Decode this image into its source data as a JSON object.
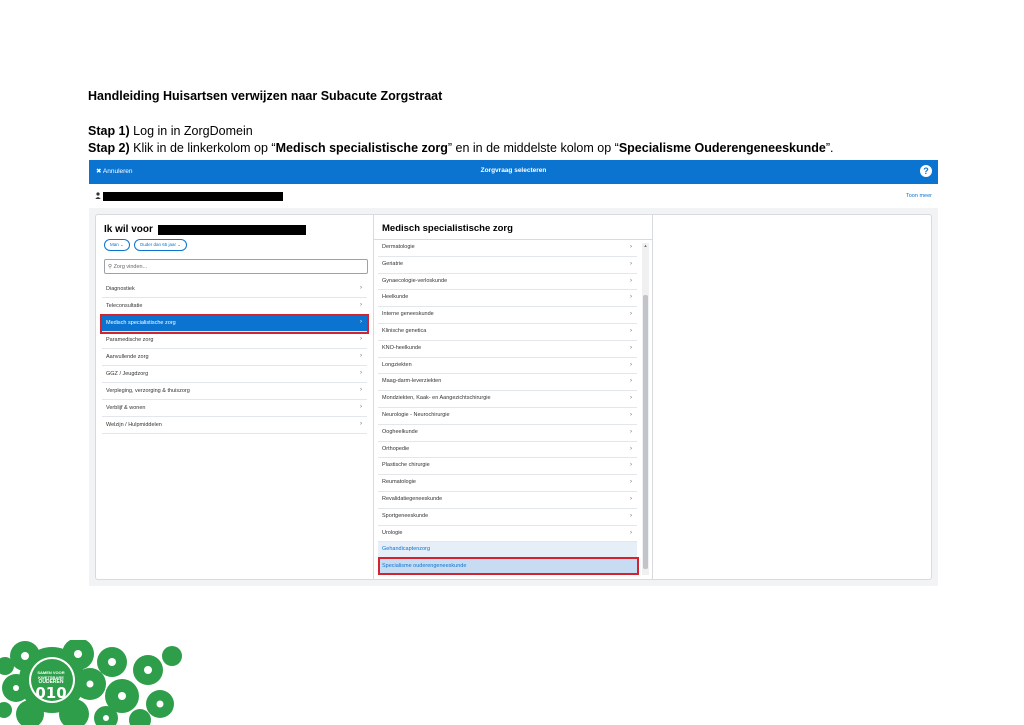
{
  "document": {
    "title": "Handleiding Huisartsen verwijzen naar Subacute Zorgstraat",
    "step1": {
      "label": "Stap 1)",
      "text": " Log in in ZorgDomein"
    },
    "step2": {
      "label": "Stap 2)",
      "text_a": " Klik in de linkerkolom op “",
      "bold_a": "Medisch specialistische zorg",
      "text_b": "” en in de middelste kolom op “",
      "bold_b": "Specialisme Ouderengeneeskunde",
      "text_c": "”."
    }
  },
  "app": {
    "cancel_label": "✖ Annuleren",
    "title": "Zorgvraag selecteren",
    "help_icon": "?",
    "person_icon": "person-icon",
    "show_more": "Toon meer",
    "left": {
      "heading": "Ik wil voor",
      "chips": [
        "Man ⌄",
        "Ouder dan 65 jaar ⌄"
      ],
      "search_placeholder": "Zorg vinden...",
      "items": [
        "Diagnostiek",
        "Teleconsultatie",
        "Medisch specialistische zorg",
        "Paramedische zorg",
        "Aanvullende zorg",
        "GGZ / Jeugdzorg",
        "Verpleging, verzorging & thuiszorg",
        "Verblijf & wonen",
        "Welzijn / Hulpmiddelen"
      ],
      "selected_index": 2
    },
    "middle": {
      "heading": "Medisch specialistische zorg",
      "items": [
        "Dermatologie",
        "Geriatrie",
        "Gynaecologie-verloskunde",
        "Heelkunde",
        "Interne geneeskunde",
        "Klinische genetica",
        "KNO-heelkunde",
        "Longziekten",
        "Maag-darm-leverziekten",
        "Mondziekten, Kaak- en Aangezichtschirurgie",
        "Neurologie - Neurochirurgie",
        "Oogheelkunde",
        "Orthopedie",
        "Plastische chirurgie",
        "Reumatologie",
        "Revalidatiegeneeskunde",
        "Sportgeneeskunde",
        "Urologie"
      ],
      "extra_items": [
        "Gehandicaptenzorg",
        "Specialisme ouderengeneeskunde"
      ]
    }
  },
  "logo": {
    "line1": "SAMEN VOOR",
    "line2": "KWETSBARE",
    "line3": "OUDEREN",
    "line4": "010",
    "color": "#2e9e4a"
  }
}
